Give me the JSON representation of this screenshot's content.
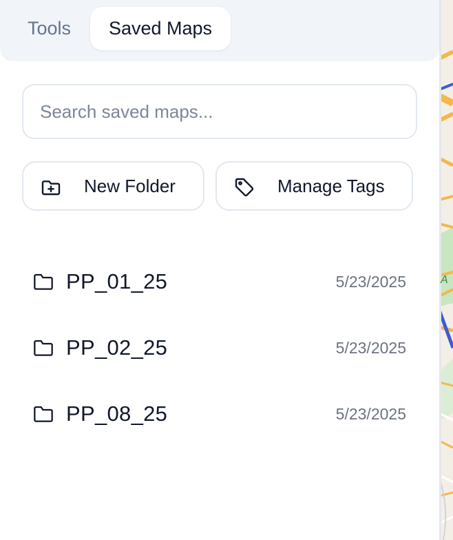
{
  "tabs": {
    "tools_label": "Tools",
    "saved_maps_label": "Saved Maps",
    "active": "saved_maps"
  },
  "search": {
    "placeholder": "Search saved maps...",
    "value": ""
  },
  "actions": {
    "new_folder_label": "New Folder",
    "new_folder_icon": "folder-plus-icon",
    "manage_tags_label": "Manage Tags",
    "manage_tags_icon": "tag-icon"
  },
  "folders": [
    {
      "name": "PP_01_25",
      "date": "5/23/2025",
      "icon": "folder-icon"
    },
    {
      "name": "PP_02_25",
      "date": "5/23/2025",
      "icon": "folder-icon"
    },
    {
      "name": "PP_08_25",
      "date": "5/23/2025",
      "icon": "folder-icon"
    }
  ],
  "map_edge": {
    "visible_label": "A"
  },
  "colors": {
    "tabbar_bg": "#f1f5f9",
    "border": "#e2e8f0",
    "text": "#0f172a",
    "muted_text": "#64748b",
    "map_road_orange": "#f5b74a",
    "map_road_blue": "#3b5bd6",
    "map_park_green": "#c8e6c0"
  }
}
